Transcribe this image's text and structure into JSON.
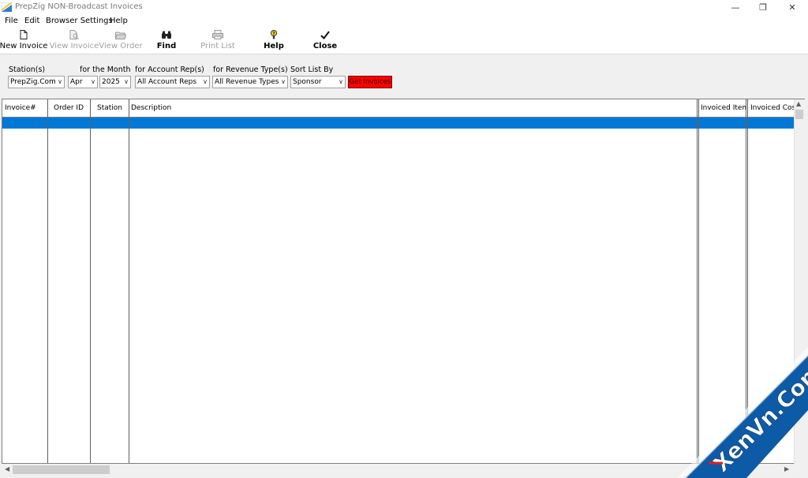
{
  "window": {
    "title": "PrepZig NON-Broadcast Invoices",
    "controls": {
      "minimize": "—",
      "restore": "❐",
      "close": "✕"
    }
  },
  "menu": {
    "file": "File",
    "edit": "Edit",
    "browser_settings": "Browser Settings",
    "help": "Help"
  },
  "toolbar": {
    "new_invoice": "New Invoice",
    "view_invoice": "View Invoice",
    "view_order": "View Order",
    "find": "Find",
    "print_list": "Print List",
    "help": "Help",
    "close": "Close"
  },
  "filters": {
    "station_label": "Station(s)",
    "station_value": "PrepZig.Com",
    "month_label": "for the Month",
    "month_value": "Apr",
    "year_value": "2025",
    "account_rep_label": "for Account Rep(s)",
    "account_rep_value": "All Account Reps",
    "revenue_type_label": "for Revenue Type(s)",
    "revenue_type_value": "All Revenue Types",
    "sort_label": "Sort List By",
    "sort_value": "Sponsor",
    "get_invoices": "Get Invoices"
  },
  "grid": {
    "columns": [
      "Invoice#",
      "Order ID",
      "Station",
      "Description",
      "Invoiced Items",
      "Invoiced Cost"
    ]
  },
  "colors": {
    "selection": "#0078d7",
    "get_button": "#ff0000",
    "watermark_bg": "#0d5aa7"
  },
  "watermark": {
    "text": "XenVn.Com"
  }
}
